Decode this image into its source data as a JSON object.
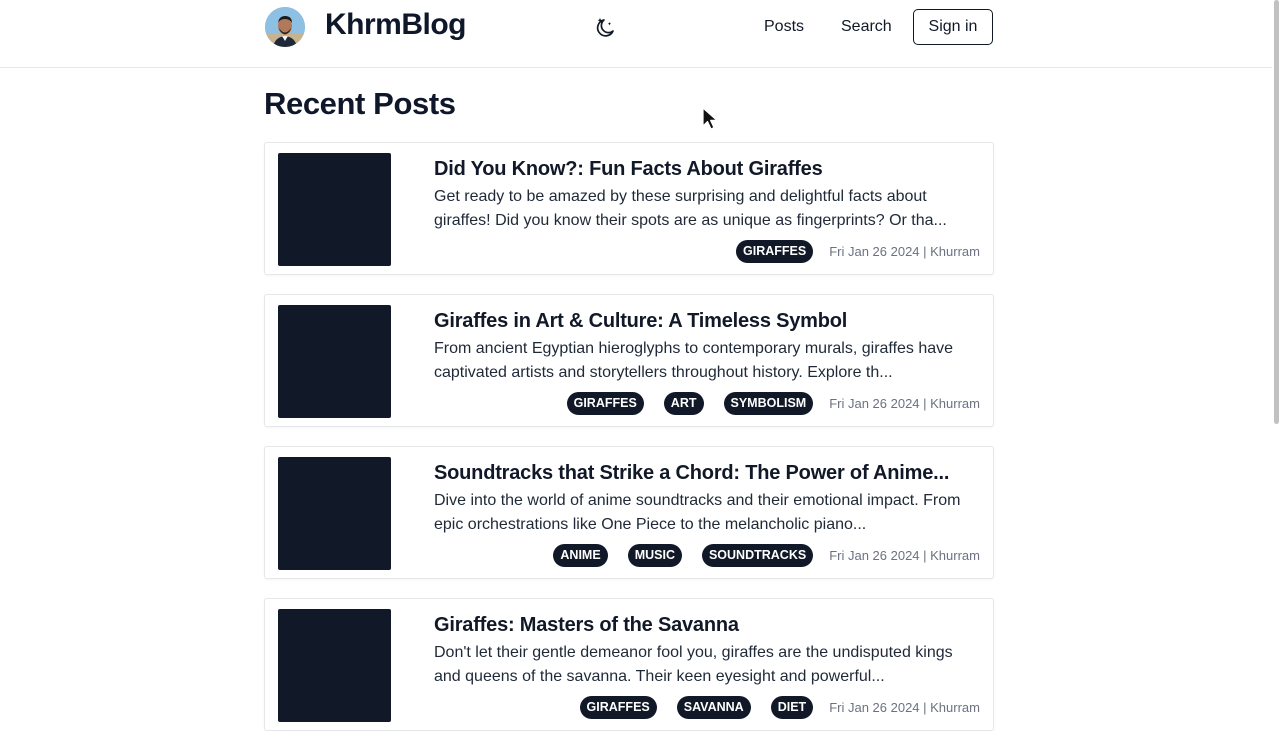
{
  "site": {
    "brand": "KhrmBlog",
    "nav": {
      "posts": "Posts",
      "search": "Search",
      "sign_in": "Sign in"
    }
  },
  "page": {
    "title": "Recent Posts"
  },
  "posts": [
    {
      "title": "Did You Know?: Fun Facts About Giraffes",
      "excerpt": "Get ready to be amazed by these surprising and delightful facts about giraffes! Did you know their spots are as unique as fingerprints? Or tha...",
      "tags": [
        "GIRAFFES"
      ],
      "meta": "Fri Jan 26 2024 | Khurram"
    },
    {
      "title": "Giraffes in Art & Culture: A Timeless Symbol",
      "excerpt": "From ancient Egyptian hieroglyphs to contemporary murals, giraffes have captivated artists and storytellers throughout history. Explore th...",
      "tags": [
        "GIRAFFES",
        "ART",
        "SYMBOLISM"
      ],
      "meta": "Fri Jan 26 2024 | Khurram"
    },
    {
      "title": "Soundtracks that Strike a Chord: The Power of Anime...",
      "excerpt": "Dive into the world of anime soundtracks and their emotional impact. From epic orchestrations like One Piece to the melancholic piano...",
      "tags": [
        "ANIME",
        "MUSIC",
        "SOUNDTRACKS"
      ],
      "meta": "Fri Jan 26 2024 | Khurram"
    },
    {
      "title": "Giraffes: Masters of the Savanna",
      "excerpt": "Don't let their gentle demeanor fool you, giraffes are the undisputed kings and queens of the savanna. Their keen eyesight and powerful...",
      "tags": [
        "GIRAFFES",
        "SAVANNA",
        "DIET"
      ],
      "meta": "Fri Jan 26 2024 | Khurram"
    }
  ],
  "icons": {
    "theme_toggle": "moon-stars-icon",
    "avatar": "avatar"
  },
  "colors": {
    "primary_dark": "#111827",
    "meta_gray": "#6b7280",
    "border": "#e5e7eb"
  }
}
